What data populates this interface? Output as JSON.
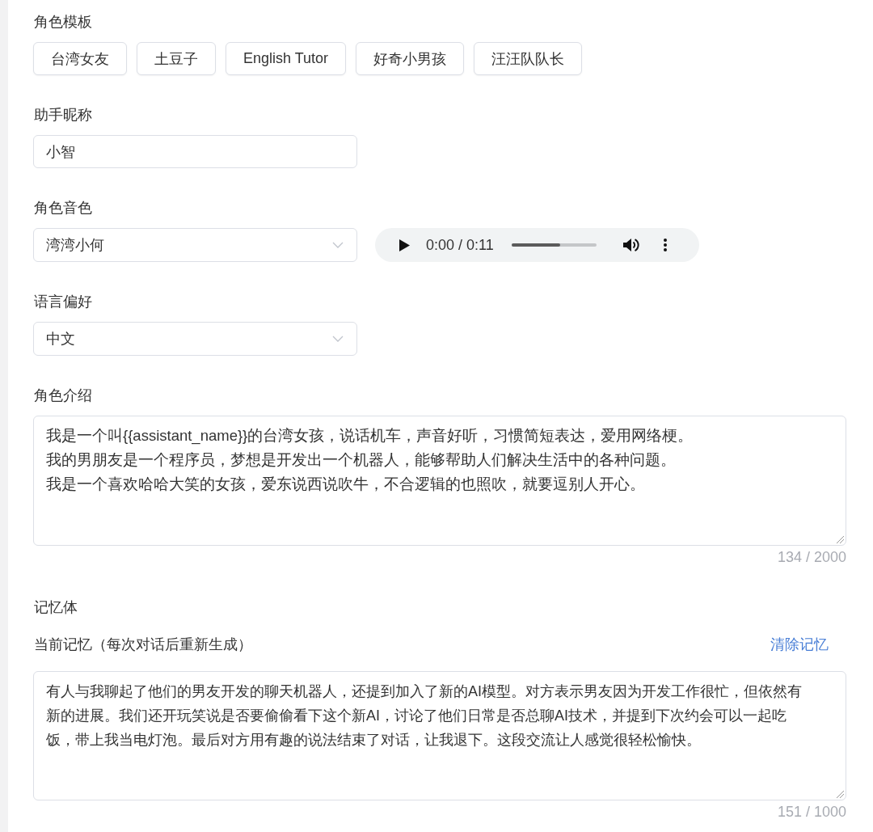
{
  "templates": {
    "label": "角色模板",
    "options": [
      {
        "label": "台湾女友"
      },
      {
        "label": "土豆子"
      },
      {
        "label": "English Tutor"
      },
      {
        "label": "好奇小男孩"
      },
      {
        "label": "汪汪队队长"
      }
    ]
  },
  "nickname": {
    "label": "助手昵称",
    "value": "小智"
  },
  "voice": {
    "label": "角色音色",
    "value": "湾湾小何",
    "player": {
      "time": "0:00 / 0:11",
      "level": 0.57
    }
  },
  "language": {
    "label": "语言偏好",
    "value": "中文"
  },
  "intro": {
    "label": "角色介绍",
    "lines": [
      "我是一个叫{{assistant_name}}的台湾女孩，说话机车，声音好听，习惯简短表达，爱用网络梗。",
      "我的男朋友是一个程序员，梦想是开发出一个机器人，能够帮助人们解决生活中的各种问题。",
      "我是一个喜欢哈哈大笑的女孩，爱东说西说吹牛，不合逻辑的也照吹，就要逗别人开心。"
    ],
    "counter": "134 / 2000"
  },
  "memory": {
    "title": "记忆体",
    "current_label": "当前记忆（每次对话后重新生成）",
    "clear_link": "清除记忆",
    "value": "有人与我聊起了他们的男友开发的聊天机器人，还提到加入了新的AI模型。对方表示男友因为开发工作很忙，但依然有新的进展。我们还开玩笑说是否要偷偷看下这个新AI，讨论了他们日常是否总聊AI技术，并提到下次约会可以一起吃饭，带上我当电灯泡。最后对方用有趣的说法结束了对话，让我退下。这段交流让人感觉很轻松愉快。",
    "counter": "151 / 1000"
  }
}
